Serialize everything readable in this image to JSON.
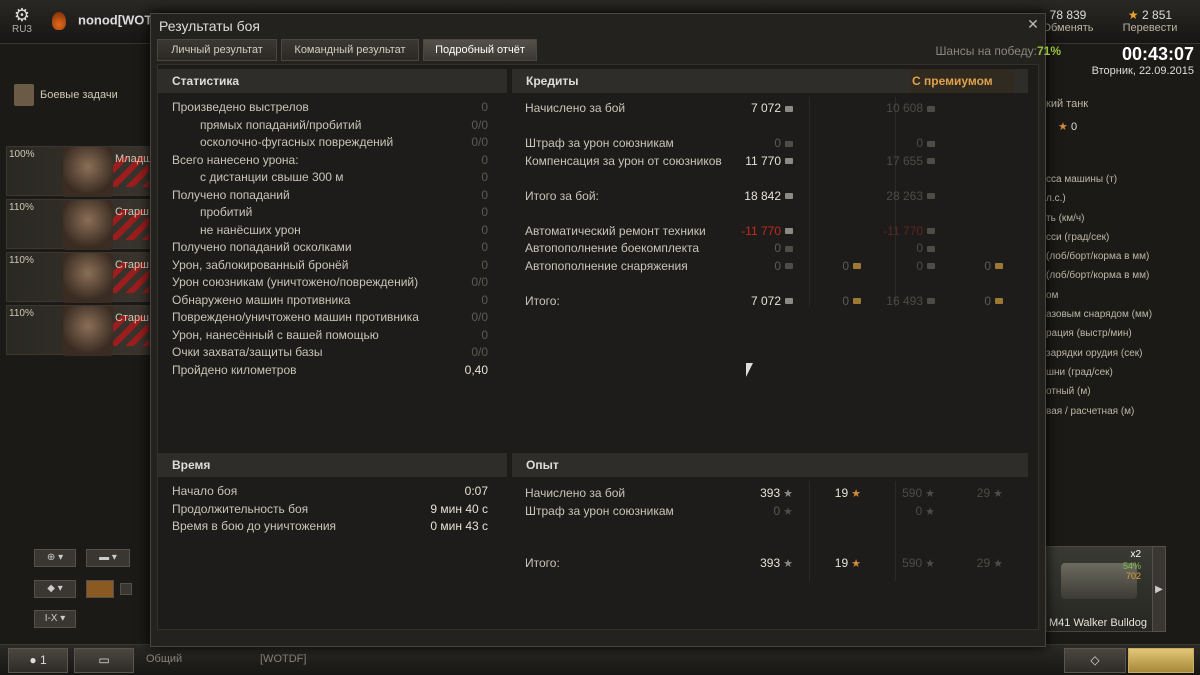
{
  "topbar": {
    "server": "RU3",
    "player": "nonod[WOTD",
    "credits": {
      "value": "78 839",
      "action": "Обменять"
    },
    "gold": {
      "value": "2 851",
      "action": "Перевести"
    }
  },
  "clock": {
    "time": "00:43:07",
    "date": "Вторник, 22.09.2015"
  },
  "sidebar": {
    "quests_label": "Боевые задачи",
    "crew": [
      {
        "pct": "100%",
        "rank": "Младш"
      },
      {
        "pct": "110%",
        "rank": "Старш"
      },
      {
        "pct": "110%",
        "rank": "Старш"
      },
      {
        "pct": "110%",
        "rank": "Старш"
      }
    ],
    "filter_tier": "I-X"
  },
  "right_panel": {
    "tank_type": "кий танк",
    "stars": "0",
    "labels": [
      "сса машины (т)",
      "л.с.)",
      "ть (км/ч)",
      "сси (град/сек)",
      "(лоб/борт/корма в мм)",
      "(лоб/борт/корма в мм)",
      "ом",
      "азовым снарядом (мм)",
      "рация (выстр/мин)",
      "зарядки орудия (сек)",
      "шни (град/сек)",
      "отный (м)",
      "вая / расчетная (м)"
    ],
    "tank_card": {
      "name": "M41 Walker Bulldog",
      "x2": "x2",
      "pct": "54%",
      "exp": "702"
    }
  },
  "dialog": {
    "title": "Результаты боя",
    "tabs": [
      "Личный результат",
      "Командный результат",
      "Подробный отчёт"
    ],
    "win_chance_label": "Шансы на победу:",
    "win_chance_value": "71%",
    "stats": {
      "header": "Статистика",
      "rows": [
        {
          "label": "Произведено выстрелов",
          "value": "0",
          "indent": false
        },
        {
          "label": "прямых попаданий/пробитий",
          "value": "0/0",
          "indent": true
        },
        {
          "label": "осколочно-фугасных повреждений",
          "value": "0/0",
          "indent": true
        },
        {
          "label": "Всего нанесено урона:",
          "value": "0",
          "indent": false
        },
        {
          "label": "с дистанции свыше 300 м",
          "value": "0",
          "indent": true
        },
        {
          "label": "Получено попаданий",
          "value": "0",
          "indent": false
        },
        {
          "label": "пробитий",
          "value": "0",
          "indent": true
        },
        {
          "label": "не нанёсших урон",
          "value": "0",
          "indent": true
        },
        {
          "label": "Получено попаданий осколками",
          "value": "0",
          "indent": false
        },
        {
          "label": "Урон, заблокированный бронёй",
          "value": "0",
          "indent": false
        },
        {
          "label": "Урон союзникам (уничтожено/повреждений)",
          "value": "0/0",
          "indent": false
        },
        {
          "label": "Обнаружено машин противника",
          "value": "0",
          "indent": false
        },
        {
          "label": "Повреждено/уничтожено машин противника",
          "value": "0/0",
          "indent": false
        },
        {
          "label": "Урон, нанесённый с вашей помощью",
          "value": "0",
          "indent": false
        },
        {
          "label": "Очки захвата/защиты базы",
          "value": "0/0",
          "indent": false
        },
        {
          "label": "Пройдено километров",
          "value": "0,40",
          "indent": false
        }
      ]
    },
    "credits": {
      "header": "Кредиты",
      "premium_header": "С премиумом",
      "rows": [
        {
          "label": "Начислено за бой",
          "v1": "7 072",
          "v2": "",
          "p1": "10 608",
          "p2": ""
        },
        {
          "label": "Штраф за урон союзникам",
          "v1": "0",
          "v2": "",
          "p1": "0",
          "p2": ""
        },
        {
          "label": "Компенсация за урон от союзников",
          "v1": "11 770",
          "v2": "",
          "p1": "17 655",
          "p2": ""
        },
        {
          "label": "Итого за бой:",
          "v1": "18 842",
          "v2": "",
          "p1": "28 263",
          "p2": ""
        },
        {
          "label": "Автоматический ремонт техники",
          "v1": "-11 770",
          "v2": "",
          "p1": "-11 770",
          "p2": ""
        },
        {
          "label": "Автопополнение боекомплекта",
          "v1": "0",
          "v2": "",
          "p1": "0",
          "p2": ""
        },
        {
          "label": "Автопополнение снаряжения",
          "v1": "0",
          "v2": "0",
          "p1": "0",
          "p2": "0"
        },
        {
          "label": "Итого:",
          "v1": "7 072",
          "v2": "0",
          "p1": "16 493",
          "p2": "0"
        }
      ]
    },
    "time": {
      "header": "Время",
      "rows": [
        {
          "label": "Начало боя",
          "value": "0:07"
        },
        {
          "label": "Продолжительность боя",
          "value": "9 мин 40 с"
        },
        {
          "label": "Время в бою до уничтожения",
          "value": "0 мин 43 с"
        }
      ]
    },
    "experience": {
      "header": "Опыт",
      "rows": [
        {
          "label": "Начислено за бой",
          "v1": "393",
          "v2": "19",
          "p1": "590",
          "p2": "29"
        },
        {
          "label": "Штраф за урон союзникам",
          "v1": "0",
          "v2": "",
          "p1": "0",
          "p2": ""
        },
        {
          "label": "Итого:",
          "v1": "393",
          "v2": "19",
          "p1": "590",
          "p2": "29"
        }
      ]
    }
  },
  "bottombar": {
    "platoon_count": "1",
    "chat_field": "Общий",
    "clan_field": "[WOTDF]"
  }
}
